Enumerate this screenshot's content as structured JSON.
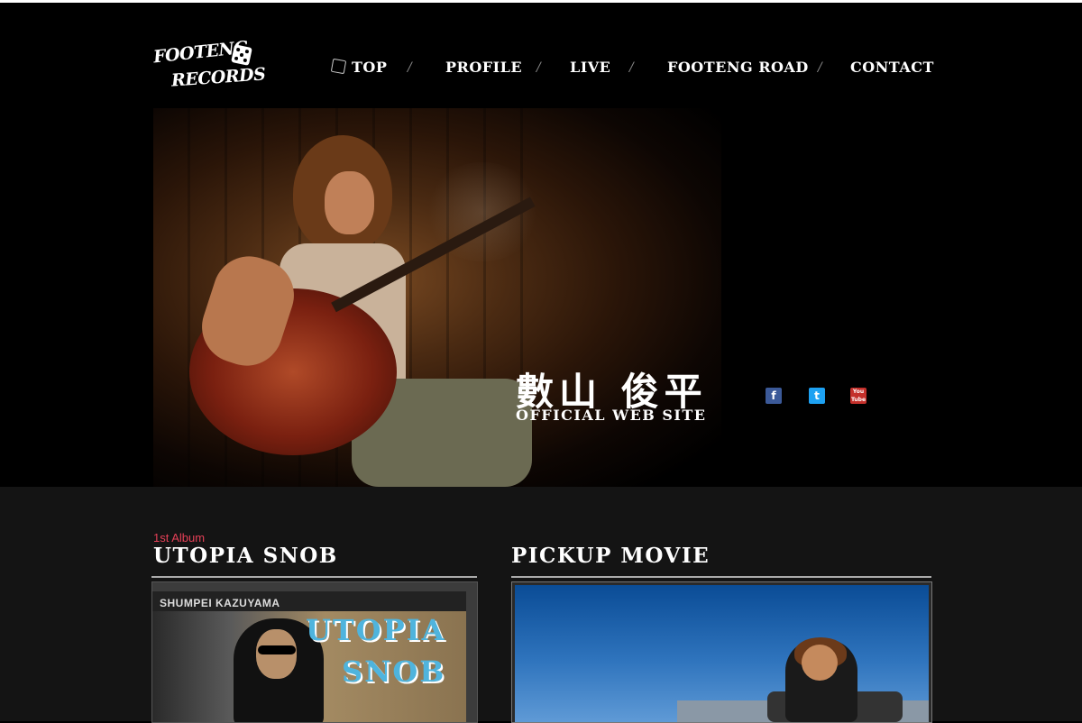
{
  "logo": {
    "line1": "FOOTENG",
    "line2": "RECORDS"
  },
  "nav": {
    "items": [
      "TOP",
      "PROFILE",
      "LIVE",
      "FOOTENG ROAD",
      "CONTACT"
    ],
    "separator": "/"
  },
  "hero": {
    "title_jp": "數山 俊平",
    "title_en": "OFFICIAL  WEB SITE"
  },
  "social": {
    "facebook": "f",
    "twitter": "t",
    "youtube": "You Tube"
  },
  "album": {
    "kicker": "1st Album",
    "title": "UTOPIA SNOB",
    "artist": "SHUMPEI KAZUYAMA",
    "cover_text_line1": "UTOPIA",
    "cover_text_line2": "SNOB"
  },
  "movie": {
    "title": "PICKUP MOVIE"
  },
  "colors": {
    "background": "#000000",
    "content_bg": "#141414",
    "accent_red": "#e54057"
  }
}
